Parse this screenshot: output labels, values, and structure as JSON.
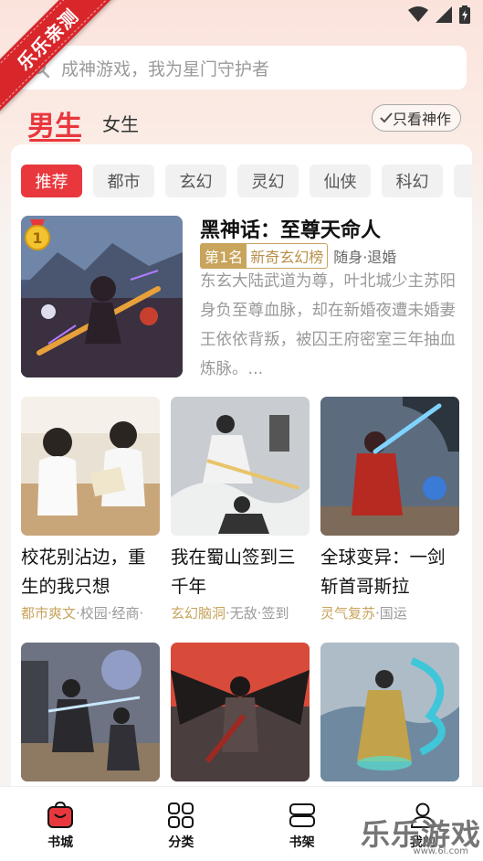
{
  "ribbon": {
    "label": "乐乐亲测"
  },
  "search": {
    "placeholder": "成神游戏，我为星门守护者"
  },
  "gender_tabs": {
    "male": "男生",
    "female": "女生"
  },
  "filter_button": {
    "label": "只看神作"
  },
  "categories": [
    "推荐",
    "都市",
    "玄幻",
    "灵幻",
    "仙侠",
    "科幻"
  ],
  "featured": {
    "rank_badge": "1",
    "title": "黑神话：至尊天命人",
    "rank_no": "第1名",
    "rank_list": "新奇玄幻榜",
    "sub_tags": "随身·退婚",
    "description": "东玄大陆武道为尊，叶北城少主苏阳身负至尊血脉，却在新婚夜遭未婚妻王依依背叛，被囚王府密室三年抽血炼脉。..."
  },
  "books": [
    {
      "title": "校花别沾边，重生的我只想",
      "tag_hl": "都市爽文",
      "tags": "·校园·经商·"
    },
    {
      "title": "我在蜀山签到三千年",
      "tag_hl": "玄幻脑洞",
      "tags": "·无敌·签到"
    },
    {
      "title": "全球变异：一剑斩首哥斯拉",
      "tag_hl": "灵气复苏",
      "tags": "·国运"
    }
  ],
  "nav": [
    {
      "label": "书城",
      "icon": "bag-icon"
    },
    {
      "label": "分类",
      "icon": "grid-icon"
    },
    {
      "label": "书架",
      "icon": "bookshelf-icon"
    },
    {
      "label": "我的",
      "icon": "person-icon"
    }
  ],
  "watermark": {
    "text": "乐乐游戏",
    "url": "www.6l.com"
  },
  "colors": {
    "accent": "#e8383d",
    "gold": "#c8a45c"
  }
}
